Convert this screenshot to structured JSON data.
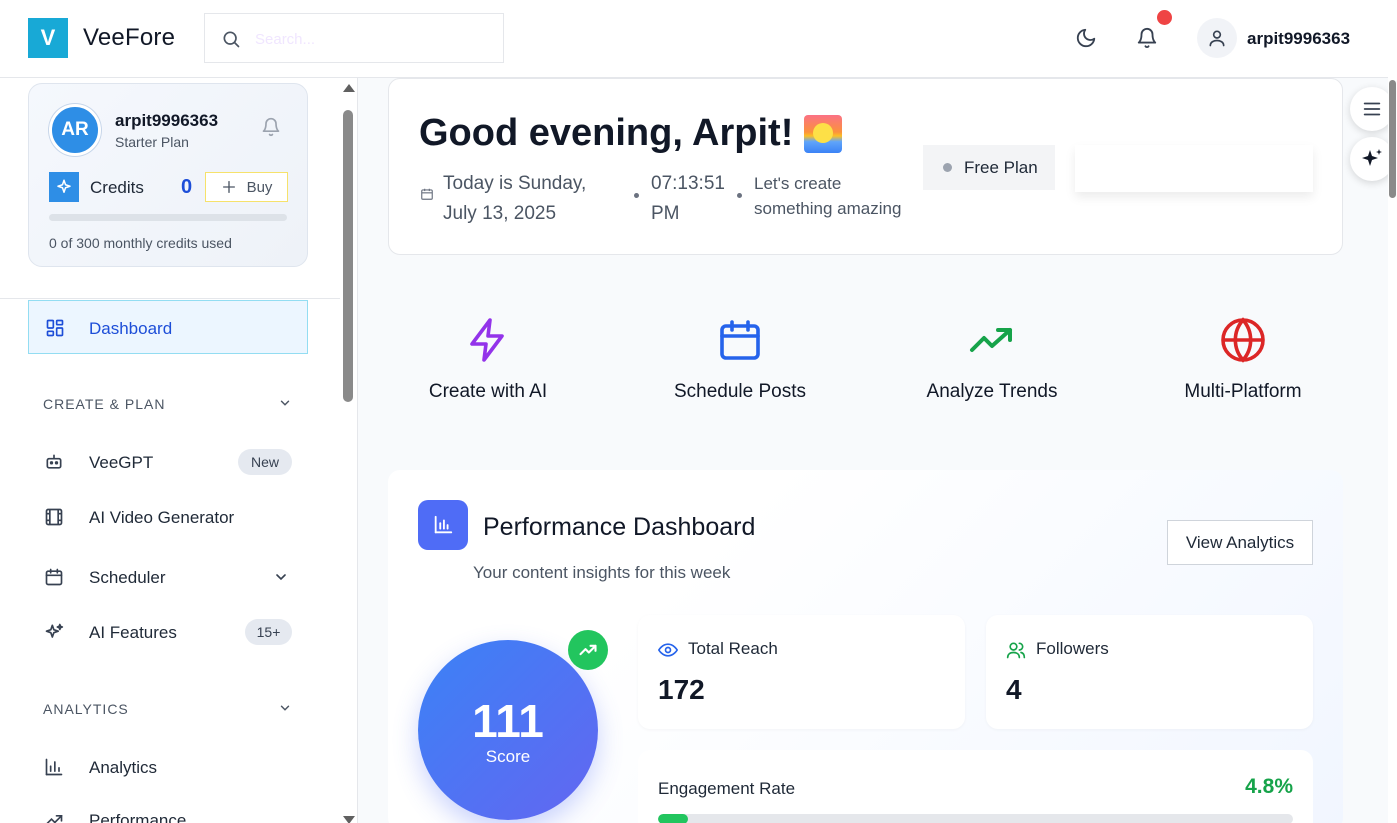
{
  "header": {
    "logo_letter": "V",
    "brand": "VeeFore",
    "search_placeholder": "Search...",
    "username": "arpit9996363",
    "icons": [
      "search-icon",
      "moon-icon",
      "bell-icon",
      "user-icon"
    ]
  },
  "sidebar": {
    "profile": {
      "initials": "AR",
      "name": "arpit9996363",
      "plan": "Starter Plan",
      "credits_label": "Credits",
      "credits_count": "0",
      "buy_label": "Buy",
      "credits_note": "0 of 300 monthly credits used",
      "credits_used_fraction": 0
    },
    "dashboard_label": "Dashboard",
    "sections": {
      "create_plan": "CREATE & PLAN",
      "analytics": "ANALYTICS"
    },
    "items": {
      "veegpt": {
        "label": "VeeGPT",
        "badge": "New"
      },
      "video": {
        "label": "AI Video Generator"
      },
      "scheduler": {
        "label": "Scheduler"
      },
      "features": {
        "label": "AI Features",
        "badge": "15+"
      },
      "analytics": {
        "label": "Analytics"
      },
      "performance": {
        "label": "Performance"
      }
    }
  },
  "greeting": {
    "title": "Good evening, Arpit!",
    "date": "Today is Sunday, July 13, 2025",
    "time": "07:13:51 PM",
    "message": "Let's create something amazing",
    "plan_badge": "Free Plan"
  },
  "quick_actions": [
    {
      "label": "Create with AI",
      "icon": "lightning-icon",
      "color": "#9333ea"
    },
    {
      "label": "Schedule Posts",
      "icon": "calendar-icon",
      "color": "#2563eb"
    },
    {
      "label": "Analyze Trends",
      "icon": "trending-up-icon",
      "color": "#16a34a"
    },
    {
      "label": "Multi-Platform",
      "icon": "globe-icon",
      "color": "#dc2626"
    }
  ],
  "performance": {
    "title": "Performance Dashboard",
    "subtitle": "Your content insights for this week",
    "view_button": "View Analytics",
    "score": "111",
    "score_label": "Score",
    "total_reach_label": "Total Reach",
    "total_reach": "172",
    "followers_label": "Followers",
    "followers": "4",
    "engagement_label": "Engagement Rate",
    "engagement_rate": "4.8%",
    "engagement_fraction": 0.048
  },
  "colors": {
    "brand": "#18a9d6",
    "active_nav": "#1d4ed8",
    "notification": "#ef4444",
    "positive": "#16a34a"
  }
}
